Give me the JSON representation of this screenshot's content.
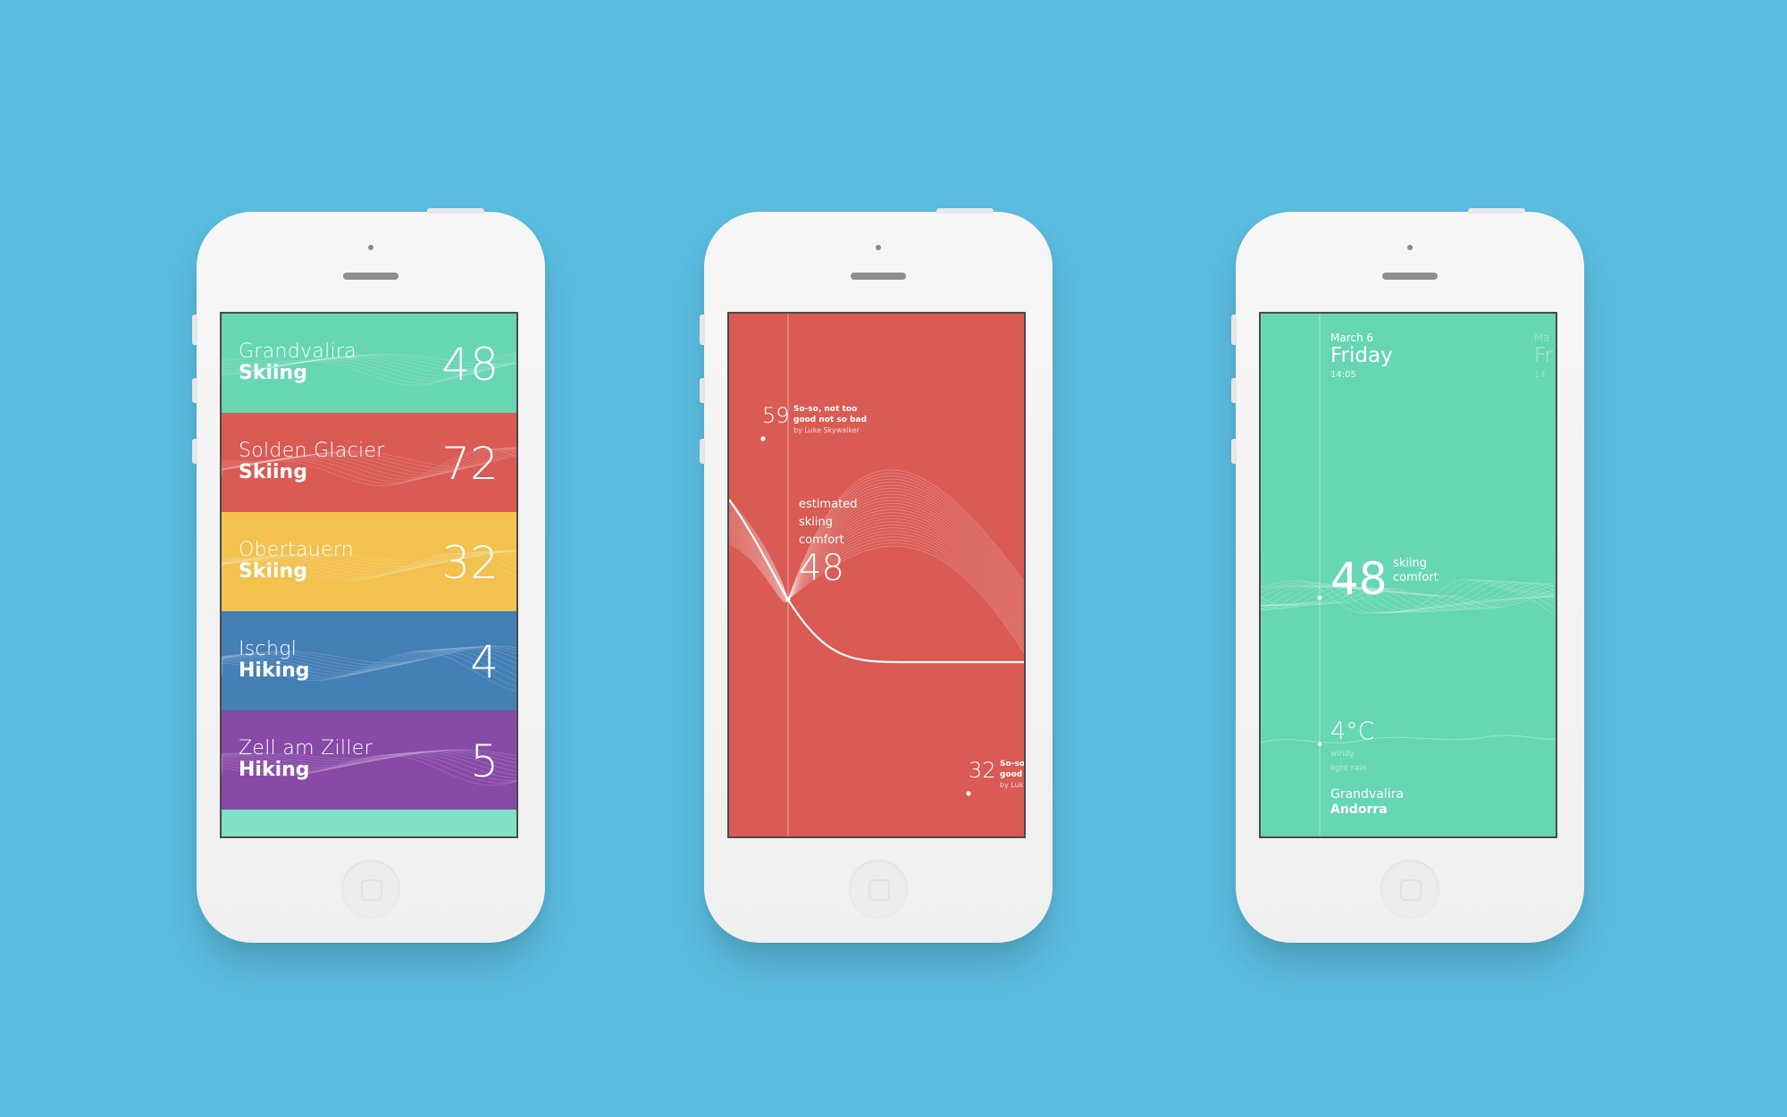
{
  "colors": {
    "background": "#5bbde0",
    "teal": "#66d6b3",
    "red": "#d95b54",
    "yellow": "#f2c14e",
    "blue": "#447fb6",
    "purple": "#874aa7",
    "mint": "#7fe0c4"
  },
  "phone1": {
    "rows": [
      {
        "place": "Grandvalira",
        "activity": "Skiing",
        "score": "48",
        "color": "#66d6b3"
      },
      {
        "place": "Solden Glacier",
        "activity": "Skiing",
        "score": "72",
        "color": "#d95b54"
      },
      {
        "place": "Obertauern",
        "activity": "Skiing",
        "score": "32",
        "color": "#f2c14e"
      },
      {
        "place": "Ischgl",
        "activity": "Hiking",
        "score": "4",
        "color": "#447fb6"
      },
      {
        "place": "Zell am Ziller",
        "activity": "Hiking",
        "score": "5",
        "color": "#874aa7"
      }
    ]
  },
  "phone2": {
    "top_score": "59",
    "top_comment": [
      "So-so, not too",
      "good not so bad"
    ],
    "top_author": "by Luke Skywalker",
    "label_lines": [
      "estimated",
      "skiing",
      "comfort"
    ],
    "main_score": "48",
    "bottom_score": "32",
    "bottom_comment": [
      "So-so",
      "good"
    ],
    "bottom_author": "by Luk"
  },
  "phone3": {
    "date": "March 6",
    "day": "Friday",
    "time": "14:05",
    "ghost_date": "Ma",
    "ghost_day": "Fr",
    "ghost_time": "14",
    "score": "48",
    "score_label": [
      "skiing",
      "comfort"
    ],
    "temperature": "4°C",
    "conditions": [
      "windy",
      "light rain"
    ],
    "resort": "Grandvalira",
    "country": "Andorra"
  }
}
